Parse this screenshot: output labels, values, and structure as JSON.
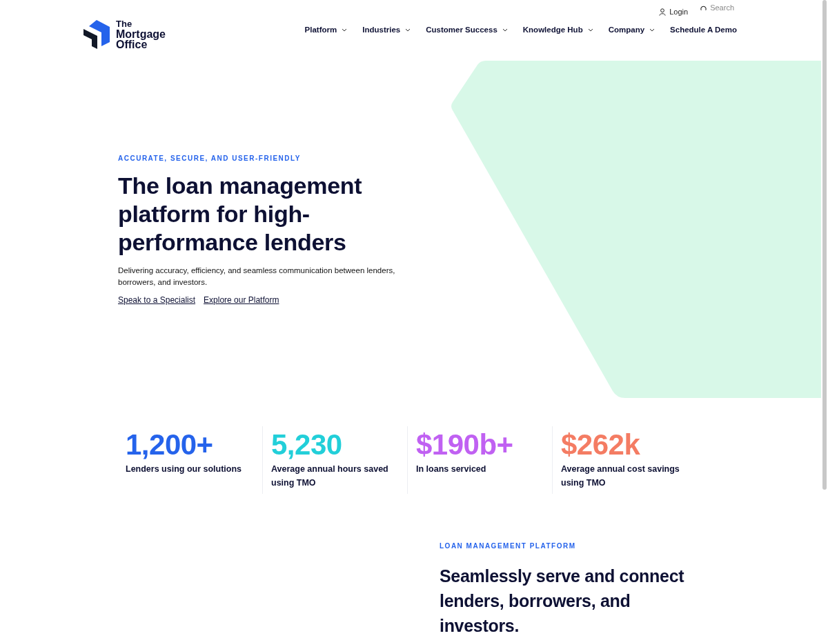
{
  "header": {
    "logo_text": [
      "The",
      "Mortgage",
      "Office"
    ],
    "utility": [
      {
        "kind": "login",
        "label": "Login"
      },
      {
        "kind": "search",
        "label": "Search"
      }
    ],
    "nav": [
      {
        "label": "Platform",
        "dropdown": true
      },
      {
        "label": "Industries",
        "dropdown": true
      },
      {
        "label": "Customer Success",
        "dropdown": true
      },
      {
        "label": "Knowledge Hub",
        "dropdown": true
      },
      {
        "label": "Company",
        "dropdown": true
      },
      {
        "label": "Schedule A Demo",
        "dropdown": false
      }
    ]
  },
  "hero": {
    "eyebrow": "ACCURATE, SECURE, AND USER-FRIENDLY",
    "title": "The loan management platform for high-performance lenders",
    "text": "Delivering accuracy, efficiency, and seamless communication between lenders, borrowers, and investors.",
    "links": [
      "Speak to a Specialist",
      "Explore our Platform"
    ]
  },
  "stats": [
    {
      "value": "1,200+",
      "label": "Lenders using our solutions",
      "color": "#2563eb"
    },
    {
      "value": "5,230",
      "label": "Average annual hours saved using TMO",
      "color": "#22cfd9"
    },
    {
      "value": "$190b+",
      "label": "In loans serviced",
      "color": "#c061f2"
    },
    {
      "value": "$262k",
      "label": "Average annual cost savings using TMO",
      "color": "#f47c63"
    }
  ],
  "platform": {
    "eyebrow": "LOAN MANAGEMENT PLATFORM",
    "title": "Seamlessly serve and connect lenders, borrowers, and investors."
  }
}
